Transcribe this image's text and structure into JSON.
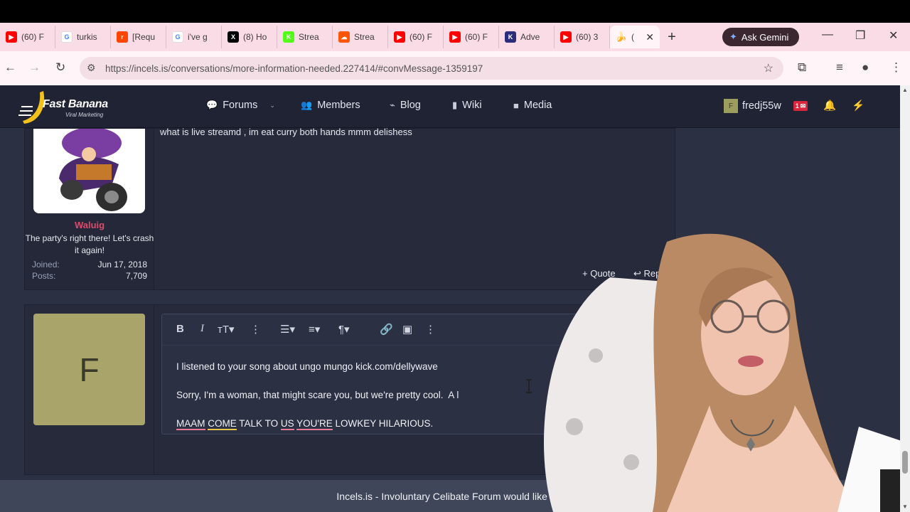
{
  "browser": {
    "tabs": [
      {
        "title": "(60) F",
        "fav_color": "#ff0000",
        "fav_glyph": "▶"
      },
      {
        "title": "turkis",
        "fav_color": "#ffffff",
        "fav_glyph": "G"
      },
      {
        "title": "[Requ",
        "fav_color": "#ff4500",
        "fav_glyph": "r"
      },
      {
        "title": "i've g",
        "fav_color": "#ffffff",
        "fav_glyph": "G"
      },
      {
        "title": "(8) Ho",
        "fav_color": "#000000",
        "fav_glyph": "X"
      },
      {
        "title": "Strea",
        "fav_color": "#53fc18",
        "fav_glyph": "K"
      },
      {
        "title": "Strea",
        "fav_color": "#ff5500",
        "fav_glyph": "☁"
      },
      {
        "title": "(60) F",
        "fav_color": "#ff0000",
        "fav_glyph": "▶"
      },
      {
        "title": "(60) F",
        "fav_color": "#ff0000",
        "fav_glyph": "▶"
      },
      {
        "title": "Adve",
        "fav_color": "#2b2d7a",
        "fav_glyph": "K"
      },
      {
        "title": "(60) 3",
        "fav_color": "#ff0000",
        "fav_glyph": "▶"
      }
    ],
    "active_tab_title": "(",
    "gemini_label": "Ask Gemini",
    "url": "https://incels.is/conversations/more-information-needed.227414/#convMessage-1359197"
  },
  "site": {
    "logo_text": "Fast Banana",
    "logo_sub": "Viral Marketing",
    "nav": [
      {
        "label": "Forums",
        "icon": "chat-icon",
        "glyph": "💬"
      },
      {
        "label": "Members",
        "icon": "users-icon",
        "glyph": "👥"
      },
      {
        "label": "Blog",
        "icon": "rss-icon",
        "glyph": "⌁"
      },
      {
        "label": "Wiki",
        "icon": "book-icon",
        "glyph": "▮"
      },
      {
        "label": "Media",
        "icon": "camera-icon",
        "glyph": "■"
      }
    ],
    "username": "fredj55w",
    "user_initial": "F",
    "conversation_badge": "1"
  },
  "message": {
    "text": "what is live streamd , im eat curry both hands mmm delishess",
    "author": "Waluig",
    "author_title": "The party's right there! Let's crash it again!",
    "joined_label": "Joined:",
    "joined_value": "Jun 17, 2018",
    "posts_label": "Posts:",
    "posts_value": "7,709",
    "quote_label": "Quote",
    "reply_label": "Reply"
  },
  "reply": {
    "avatar_initial": "F",
    "line1": "I listened to your song about ungo mungo kick.com/dellywave",
    "line2": "Sorry, I'm a woman, that might scare you, but we're pretty cool.  A l",
    "line3_words": [
      "MAAM",
      "COME",
      "TALK",
      "TO",
      "US",
      "YOU'RE",
      "LOWKEY",
      "HILARIOUS."
    ]
  },
  "cookie_notice": "Incels.is - Involuntary Celibate Forum would like your permission"
}
